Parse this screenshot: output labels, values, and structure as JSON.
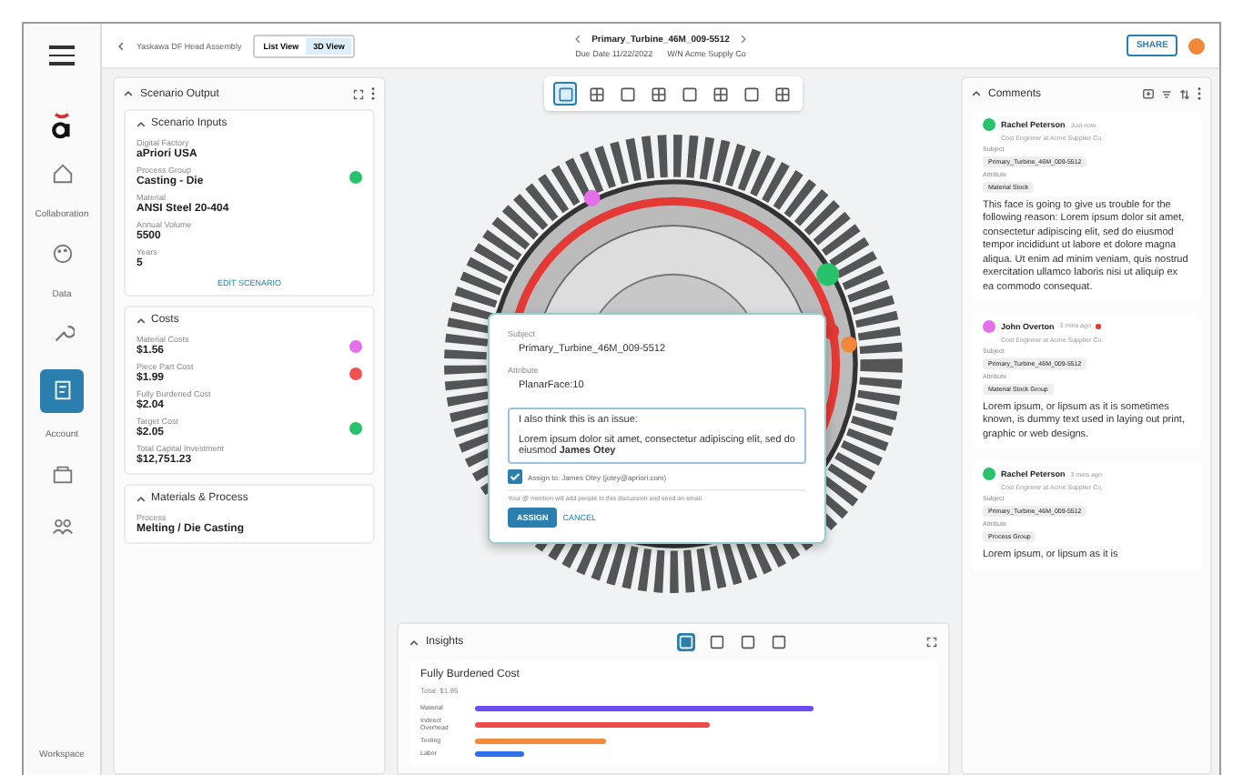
{
  "nav": {
    "labels": [
      "Collaboration",
      "Data",
      "Account",
      "Workspace"
    ],
    "items": [
      {
        "selected": false
      },
      {
        "selected": false
      },
      {
        "selected": false
      },
      {
        "selected": true
      },
      {
        "selected": false
      },
      {
        "selected": false
      }
    ]
  },
  "top_bar": {
    "breadcrumb": "Yaskawa DF Head Assembly",
    "views": [
      {
        "label": "List View",
        "selected": false
      },
      {
        "label": "3D View",
        "selected": true
      }
    ],
    "part": "Primary_Turbine_46M_009-5512",
    "due_date": "Due Date 11/22/2022",
    "supplier": "W/N Acme Supply Co",
    "share": "SHARE"
  },
  "scenario_output": {
    "title": "Scenario Output",
    "sections": [
      {
        "title": "Scenario Inputs",
        "action": "EDIT SCENARIO",
        "fields": [
          {
            "label": "Digital Factory",
            "value": "aPriori USA"
          },
          {
            "label": "Process Group",
            "value": "Casting - Die",
            "color": "#27c26a"
          },
          {
            "label": "Material",
            "value": "ANSI Steel 20-404"
          },
          {
            "label": "Annual Volume",
            "value": "5500"
          },
          {
            "label": "Years",
            "value": "5"
          }
        ]
      },
      {
        "title": "Costs",
        "fields": [
          {
            "label": "Material Costs",
            "value": "$1.56",
            "color": "#e46fe8"
          },
          {
            "label": "Piece Part Cost",
            "value": "$1.99",
            "color": "#ef5350"
          },
          {
            "label": "Fully Burdened Cost",
            "value": "$2.04"
          },
          {
            "label": "Target Cost",
            "value": "$2.05",
            "color": "#27c26a"
          },
          {
            "label": "Total Capital Investment",
            "value": "$12,751.23"
          }
        ]
      },
      {
        "title": "Materials & Process",
        "fields": [
          {
            "label": "Process",
            "value": "Melting / Die Casting"
          }
        ]
      }
    ]
  },
  "viewer_toolbar": [
    {
      "selected": true
    },
    {
      "selected": false
    },
    {
      "selected": false
    },
    {
      "selected": false
    },
    {
      "selected": false
    },
    {
      "selected": false
    },
    {
      "selected": false
    },
    {
      "selected": false
    }
  ],
  "comment_dialog": {
    "subject_label": "Subject",
    "subject": "Primary_Turbine_46M_009-5512",
    "attribute_label": "Attribute",
    "attribute": "PlanarFace:10",
    "message_lines": [
      "I also think this is an issue:",
      "Lorem ipsum dolor sit amet, consectetur adipiscing elit, sed do eiusmod  **James Otey**"
    ],
    "assign": {
      "checked": true,
      "label": "Assign to: James Otey (jotey@apriori.com)"
    },
    "note": "Your @ mention will add people to this discussion and send an email.",
    "buttons": [
      "ASSIGN",
      "CANCEL"
    ]
  },
  "insights": {
    "title": "Insights",
    "tabs": [
      {
        "selected": true
      },
      {
        "selected": false
      },
      {
        "selected": false
      },
      {
        "selected": false
      }
    ],
    "card_title": "Fully Burdened Cost",
    "total": "Total: $1.95",
    "rows": [
      "Material",
      "Indirect Overhead",
      "Tooling",
      "Labor"
    ]
  },
  "comments": {
    "title": "Comments",
    "items": [
      {
        "name": "Rachel Peterson",
        "time": "Just now",
        "unread": false,
        "color": "#27c26a",
        "role": "Cost Engineer at Acme Supplier Co.",
        "subject_label": "Subject",
        "subject": "Primary_Turbine_46M_009-5512",
        "attribute_label": "Attribute",
        "attribute": "Material Stock",
        "body": "This face is going to give us trouble for the following reason: Lorem ipsum dolor sit amet, consectetur adipiscing elit, sed do eiusmod tempor incididunt ut labore et dolore magna aliqua. Ut enim ad minim veniam, quis nostrud exercitation ullamco laboris nisi ut aliquip ex ea commodo consequat."
      },
      {
        "name": "John Overton",
        "time": "3 mins ago",
        "unread": true,
        "color": "#e46fe8",
        "role": "Cost Engineer at Acme Supplier Co.",
        "subject_label": "Subject",
        "subject": "Primary_Turbine_46M_009-5512",
        "attribute_label": "Attribute",
        "attribute": "Material Stock Group",
        "body": "Lorem ipsum, or lipsum as it is sometimes known, is dummy text used in laying out print, graphic or web designs."
      },
      {
        "name": "Rachel Peterson",
        "time": "3 mins ago",
        "unread": false,
        "color": "#27c26a",
        "role": "Cost Engineer at Acme Supplier Co.",
        "subject_label": "Subject",
        "subject": "Primary_Turbine_46M_009-5512",
        "attribute_label": "Attribute",
        "attribute": "Process Group",
        "body": "Lorem ipsum, or lipsum as it is"
      }
    ]
  }
}
